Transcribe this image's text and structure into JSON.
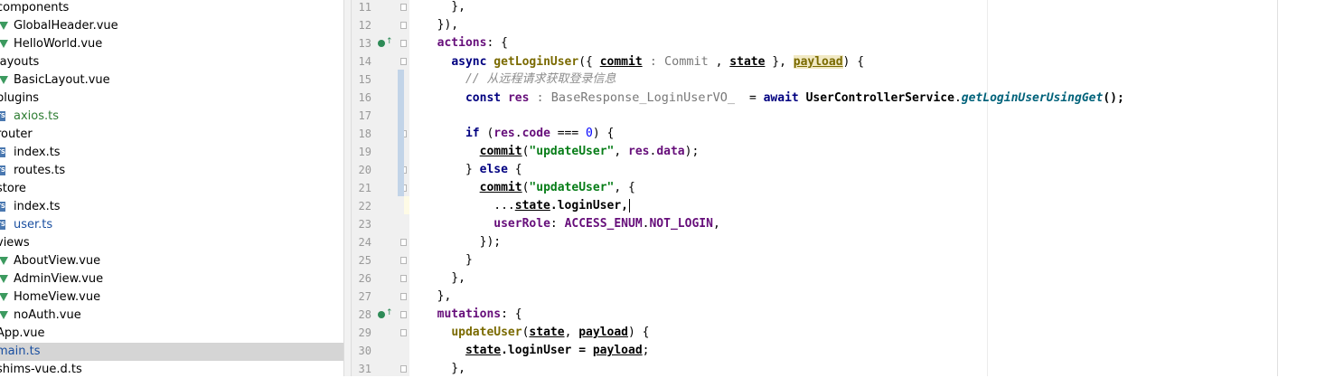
{
  "tree": [
    {
      "label": "components",
      "kind": "dir",
      "indent": 0
    },
    {
      "label": "GlobalHeader.vue",
      "kind": "vue",
      "indent": 1
    },
    {
      "label": "HelloWorld.vue",
      "kind": "vue",
      "indent": 1
    },
    {
      "label": "layouts",
      "kind": "dir",
      "indent": 0
    },
    {
      "label": "BasicLayout.vue",
      "kind": "vue",
      "indent": 1
    },
    {
      "label": "plugins",
      "kind": "dir",
      "indent": 0
    },
    {
      "label": "axios.ts",
      "kind": "ts",
      "indent": 1,
      "color": "green"
    },
    {
      "label": "router",
      "kind": "dir",
      "indent": 0
    },
    {
      "label": "index.ts",
      "kind": "ts",
      "indent": 1
    },
    {
      "label": "routes.ts",
      "kind": "ts",
      "indent": 1
    },
    {
      "label": "store",
      "kind": "dir",
      "indent": 0
    },
    {
      "label": "index.ts",
      "kind": "ts",
      "indent": 1
    },
    {
      "label": "user.ts",
      "kind": "ts",
      "indent": 1,
      "color": "blue"
    },
    {
      "label": "views",
      "kind": "dir",
      "indent": 0
    },
    {
      "label": "AboutView.vue",
      "kind": "vue",
      "indent": 1
    },
    {
      "label": "AdminView.vue",
      "kind": "vue",
      "indent": 1
    },
    {
      "label": "HomeView.vue",
      "kind": "vue",
      "indent": 1
    },
    {
      "label": "noAuth.vue",
      "kind": "vue",
      "indent": 1
    },
    {
      "label": "App.vue",
      "kind": "file",
      "indent": 0
    },
    {
      "label": "main.ts",
      "kind": "file",
      "indent": 0,
      "selected": true,
      "color": "blue"
    },
    {
      "label": "shims-vue.d.ts",
      "kind": "file",
      "indent": 0
    }
  ],
  "editor": {
    "lines": [
      {
        "n": "11",
        "fold": true,
        "tokens": [
          [
            "    },",
            ""
          ]
        ]
      },
      {
        "n": "12",
        "fold": true,
        "tokens": [
          [
            "  }),",
            ""
          ]
        ]
      },
      {
        "n": "13",
        "marker": true,
        "tokens": [
          [
            "  ",
            ""
          ],
          [
            "actions",
            "pp"
          ],
          [
            ": {",
            ""
          ]
        ]
      },
      {
        "n": "14",
        "fold": true,
        "tokens": [
          [
            "    ",
            ""
          ],
          [
            "async ",
            "kw"
          ],
          [
            "getLoginUser",
            "fn"
          ],
          [
            "({ ",
            ""
          ],
          [
            "commit",
            "ul"
          ],
          [
            " : Commit",
            "hint"
          ],
          [
            " , ",
            ""
          ],
          [
            "state",
            "ul"
          ],
          [
            " }, ",
            ""
          ],
          [
            "payload",
            "hl ul"
          ],
          [
            ") {",
            ""
          ]
        ]
      },
      {
        "n": "15",
        "tokens": [
          [
            "      ",
            ""
          ],
          [
            "// 从远程请求获取登录信息",
            "cm"
          ]
        ]
      },
      {
        "n": "16",
        "tokens": [
          [
            "      ",
            ""
          ],
          [
            "const ",
            "kw"
          ],
          [
            "res",
            "pp"
          ],
          [
            " : BaseResponse_LoginUserVO_ ",
            "hint"
          ],
          [
            " = ",
            ""
          ],
          [
            "await ",
            "kw"
          ],
          [
            "UserControllerService",
            "bold"
          ],
          [
            ".",
            ""
          ],
          [
            "getLoginUserUsingGet",
            "mi"
          ],
          [
            "();",
            "bold"
          ]
        ]
      },
      {
        "n": "17",
        "tokens": [
          [
            "",
            ""
          ]
        ]
      },
      {
        "n": "18",
        "fold": true,
        "tokens": [
          [
            "      ",
            ""
          ],
          [
            "if ",
            "kw"
          ],
          [
            "(",
            ""
          ],
          [
            "res",
            "pp"
          ],
          [
            ".",
            ""
          ],
          [
            "code",
            "pp"
          ],
          [
            " === ",
            ""
          ],
          [
            "0",
            "num"
          ],
          [
            ") {",
            ""
          ]
        ]
      },
      {
        "n": "19",
        "tokens": [
          [
            "        ",
            ""
          ],
          [
            "commit",
            "ul"
          ],
          [
            "(",
            ""
          ],
          [
            "\"updateUser\"",
            "str"
          ],
          [
            ", ",
            ""
          ],
          [
            "res",
            "pp"
          ],
          [
            ".",
            ""
          ],
          [
            "data",
            "pp"
          ],
          [
            ");",
            ""
          ]
        ]
      },
      {
        "n": "20",
        "fold": true,
        "tokens": [
          [
            "      } ",
            ""
          ],
          [
            "else ",
            "kw"
          ],
          [
            "{",
            ""
          ]
        ]
      },
      {
        "n": "21",
        "fold": true,
        "tokens": [
          [
            "        ",
            ""
          ],
          [
            "commit",
            "ul"
          ],
          [
            "(",
            ""
          ],
          [
            "\"updateUser\"",
            "str"
          ],
          [
            ", {",
            ""
          ]
        ]
      },
      {
        "n": "22",
        "current": true,
        "tokens": [
          [
            "          ...",
            ""
          ],
          [
            "state",
            "ul"
          ],
          [
            ".loginUser,",
            "bold"
          ]
        ]
      },
      {
        "n": "23",
        "tokens": [
          [
            "          ",
            ""
          ],
          [
            "userRole",
            "pp"
          ],
          [
            ": ",
            ""
          ],
          [
            "ACCESS_ENUM",
            "pp"
          ],
          [
            ".",
            ""
          ],
          [
            "NOT_LOGIN",
            "pp"
          ],
          [
            ",",
            ""
          ]
        ]
      },
      {
        "n": "24",
        "fold": true,
        "tokens": [
          [
            "        });",
            ""
          ]
        ]
      },
      {
        "n": "25",
        "fold": true,
        "tokens": [
          [
            "      }",
            ""
          ]
        ]
      },
      {
        "n": "26",
        "fold": true,
        "tokens": [
          [
            "    },",
            ""
          ]
        ]
      },
      {
        "n": "27",
        "fold": true,
        "tokens": [
          [
            "  },",
            ""
          ]
        ]
      },
      {
        "n": "28",
        "marker": true,
        "tokens": [
          [
            "  ",
            ""
          ],
          [
            "mutations",
            "pp"
          ],
          [
            ": {",
            ""
          ]
        ]
      },
      {
        "n": "29",
        "fold": true,
        "tokens": [
          [
            "    ",
            ""
          ],
          [
            "updateUser",
            "fn"
          ],
          [
            "(",
            ""
          ],
          [
            "state",
            "ul"
          ],
          [
            ", ",
            ""
          ],
          [
            "payload",
            "ul"
          ],
          [
            ") {",
            ""
          ]
        ]
      },
      {
        "n": "30",
        "tokens": [
          [
            "      ",
            ""
          ],
          [
            "state",
            "ul"
          ],
          [
            ".loginUser = ",
            "bold"
          ],
          [
            "payload",
            "ul"
          ],
          [
            ";",
            ""
          ]
        ]
      },
      {
        "n": "31",
        "fold": true,
        "tokens": [
          [
            "    },",
            ""
          ]
        ]
      }
    ]
  },
  "colors": {
    "accent": "#000080",
    "selection": "#d5d5d5",
    "current_line": "#fefbe6"
  }
}
